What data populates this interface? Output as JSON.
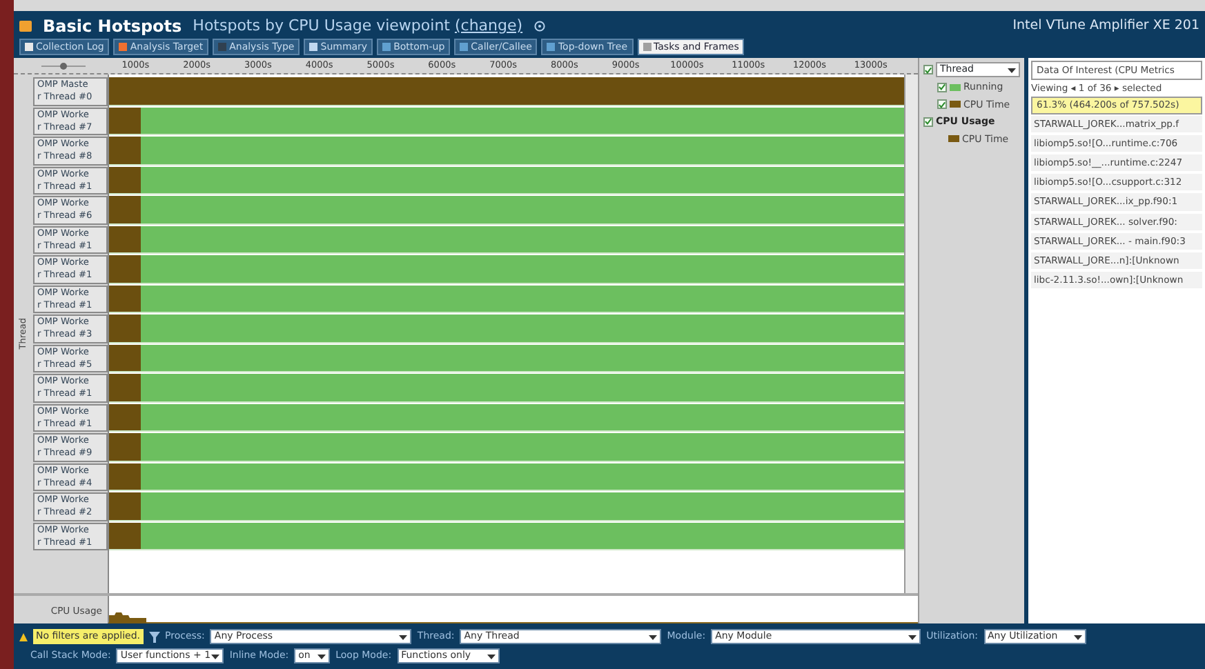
{
  "header": {
    "title": "Basic Hotspots",
    "subtitle": "Hotspots by CPU Usage viewpoint",
    "change_link": "(change)",
    "product": "Intel VTune Amplifier XE 201"
  },
  "tabs": [
    {
      "label": "Collection Log",
      "selected": false
    },
    {
      "label": "Analysis Target",
      "selected": false
    },
    {
      "label": "Analysis Type",
      "selected": false
    },
    {
      "label": "Summary",
      "selected": false
    },
    {
      "label": "Bottom-up",
      "selected": false
    },
    {
      "label": "Caller/Callee",
      "selected": false
    },
    {
      "label": "Top-down Tree",
      "selected": false
    },
    {
      "label": "Tasks and Frames",
      "selected": true
    }
  ],
  "timeline": {
    "ruler": [
      "1000s",
      "2000s",
      "3000s",
      "4000s",
      "5000s",
      "6000s",
      "7000s",
      "8000s",
      "9000s",
      "10000s",
      "11000s",
      "12000s",
      "13000s"
    ],
    "axis_label": "Thread",
    "threads": [
      {
        "lines": [
          "OMP Maste",
          "r Thread #0"
        ],
        "kind": "master"
      },
      {
        "lines": [
          "OMP Worke",
          "r Thread #7"
        ],
        "kind": "worker"
      },
      {
        "lines": [
          "OMP Worke",
          "r Thread #8"
        ],
        "kind": "worker"
      },
      {
        "lines": [
          "OMP Worke",
          "r Thread #1"
        ],
        "kind": "worker"
      },
      {
        "lines": [
          "OMP Worke",
          "r Thread #6"
        ],
        "kind": "worker"
      },
      {
        "lines": [
          "OMP Worke",
          "r Thread #1"
        ],
        "kind": "worker"
      },
      {
        "lines": [
          "OMP Worke",
          "r Thread #1"
        ],
        "kind": "worker"
      },
      {
        "lines": [
          "OMP Worke",
          "r Thread #1"
        ],
        "kind": "worker"
      },
      {
        "lines": [
          "OMP Worke",
          "r Thread #3"
        ],
        "kind": "worker"
      },
      {
        "lines": [
          "OMP Worke",
          "r Thread #5"
        ],
        "kind": "worker"
      },
      {
        "lines": [
          "OMP Worke",
          "r Thread #1"
        ],
        "kind": "worker"
      },
      {
        "lines": [
          "OMP Worke",
          "r Thread #1"
        ],
        "kind": "worker"
      },
      {
        "lines": [
          "OMP Worke",
          "r Thread #9"
        ],
        "kind": "worker"
      },
      {
        "lines": [
          "OMP Worke",
          "r Thread #4"
        ],
        "kind": "worker"
      },
      {
        "lines": [
          "OMP Worke",
          "r Thread #2"
        ],
        "kind": "worker"
      },
      {
        "lines": [
          "OMP Worke",
          "r Thread #1"
        ],
        "kind": "worker"
      }
    ],
    "cpu_usage_label": "CPU Usage"
  },
  "legend": {
    "dropdown": "Thread",
    "dropdown_checked": true,
    "items": [
      {
        "label": "Running",
        "checked": true,
        "kind": "sub",
        "color": "#6cbf5f"
      },
      {
        "label": "CPU Time",
        "checked": true,
        "kind": "sub",
        "color": "#7a5a12"
      },
      {
        "label": "CPU Usage",
        "checked": true,
        "kind": "group"
      },
      {
        "label": "CPU Time",
        "kind": "leaf",
        "color": "#7a5a12"
      }
    ]
  },
  "details": {
    "title": "Data Of Interest (CPU Metrics",
    "viewing": "Viewing ◂ 1 of 36 ▸ selected",
    "percent": "61.3% (464.200s of 757.502s)",
    "items": [
      "STARWALL_JOREK...matrix_pp.f",
      "libiomp5.so![O...runtime.c:706",
      "libiomp5.so!__...runtime.c:2247",
      "libiomp5.so![O...csupport.c:312",
      "STARWALL_JOREK...ix_pp.f90:1",
      "STARWALL_JOREK... solver.f90:",
      "STARWALL_JOREK... - main.f90:3",
      "STARWALL_JORE...n]:[Unknown",
      "libc-2.11.3.so!...own]:[Unknown"
    ]
  },
  "filters": {
    "status": "No filters are applied.",
    "row1": [
      {
        "label": "Process:",
        "value": "Any Process"
      },
      {
        "label": "Thread:",
        "value": "Any Thread"
      },
      {
        "label": "Module:",
        "value": "Any Module"
      },
      {
        "label": "Utilization:",
        "value": "Any Utilization"
      }
    ],
    "row2": [
      {
        "label": "Call Stack Mode:",
        "value": "User functions + 1"
      },
      {
        "label": "Inline Mode:",
        "value": "on"
      },
      {
        "label": "Loop Mode:",
        "value": "Functions only"
      }
    ]
  }
}
